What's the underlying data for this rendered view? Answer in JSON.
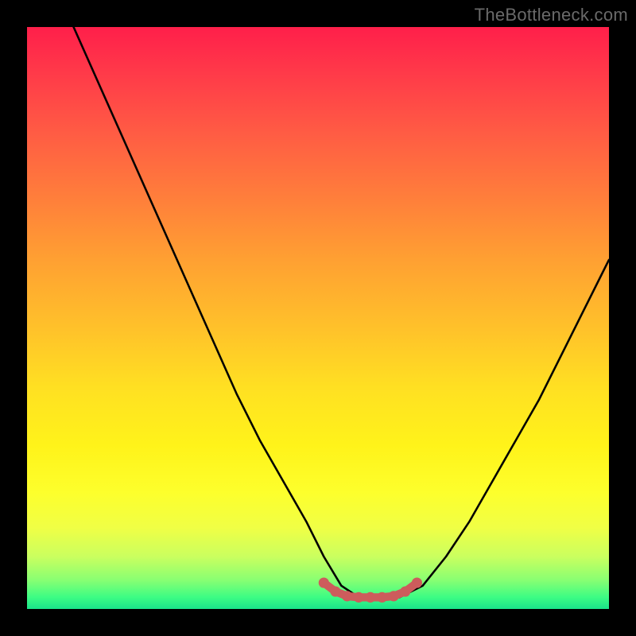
{
  "watermark": "TheBottleneck.com",
  "chart_data": {
    "type": "line",
    "title": "",
    "xlabel": "",
    "ylabel": "",
    "xlim": [
      0,
      100
    ],
    "ylim": [
      0,
      100
    ],
    "grid": false,
    "legend": false,
    "gradient_colors": {
      "top": "#ff1f4a",
      "mid": "#ffe022",
      "bottom": "#1ae38a"
    },
    "series": [
      {
        "name": "bottleneck-curve",
        "color": "#000000",
        "x": [
          8,
          12,
          16,
          20,
          24,
          28,
          32,
          36,
          40,
          44,
          48,
          51,
          54,
          57,
          60,
          64,
          68,
          72,
          76,
          80,
          84,
          88,
          92,
          96,
          100
        ],
        "y": [
          100,
          91,
          82,
          73,
          64,
          55,
          46,
          37,
          29,
          22,
          15,
          9,
          4,
          2,
          2,
          2,
          4,
          9,
          15,
          22,
          29,
          36,
          44,
          52,
          60
        ]
      },
      {
        "name": "optimal-band",
        "color": "#cd5c5c",
        "x": [
          51,
          53,
          55,
          57,
          59,
          61,
          63,
          65,
          67
        ],
        "y": [
          4.5,
          3.0,
          2.2,
          2.0,
          2.0,
          2.0,
          2.2,
          3.0,
          4.5
        ]
      }
    ],
    "annotations": []
  }
}
